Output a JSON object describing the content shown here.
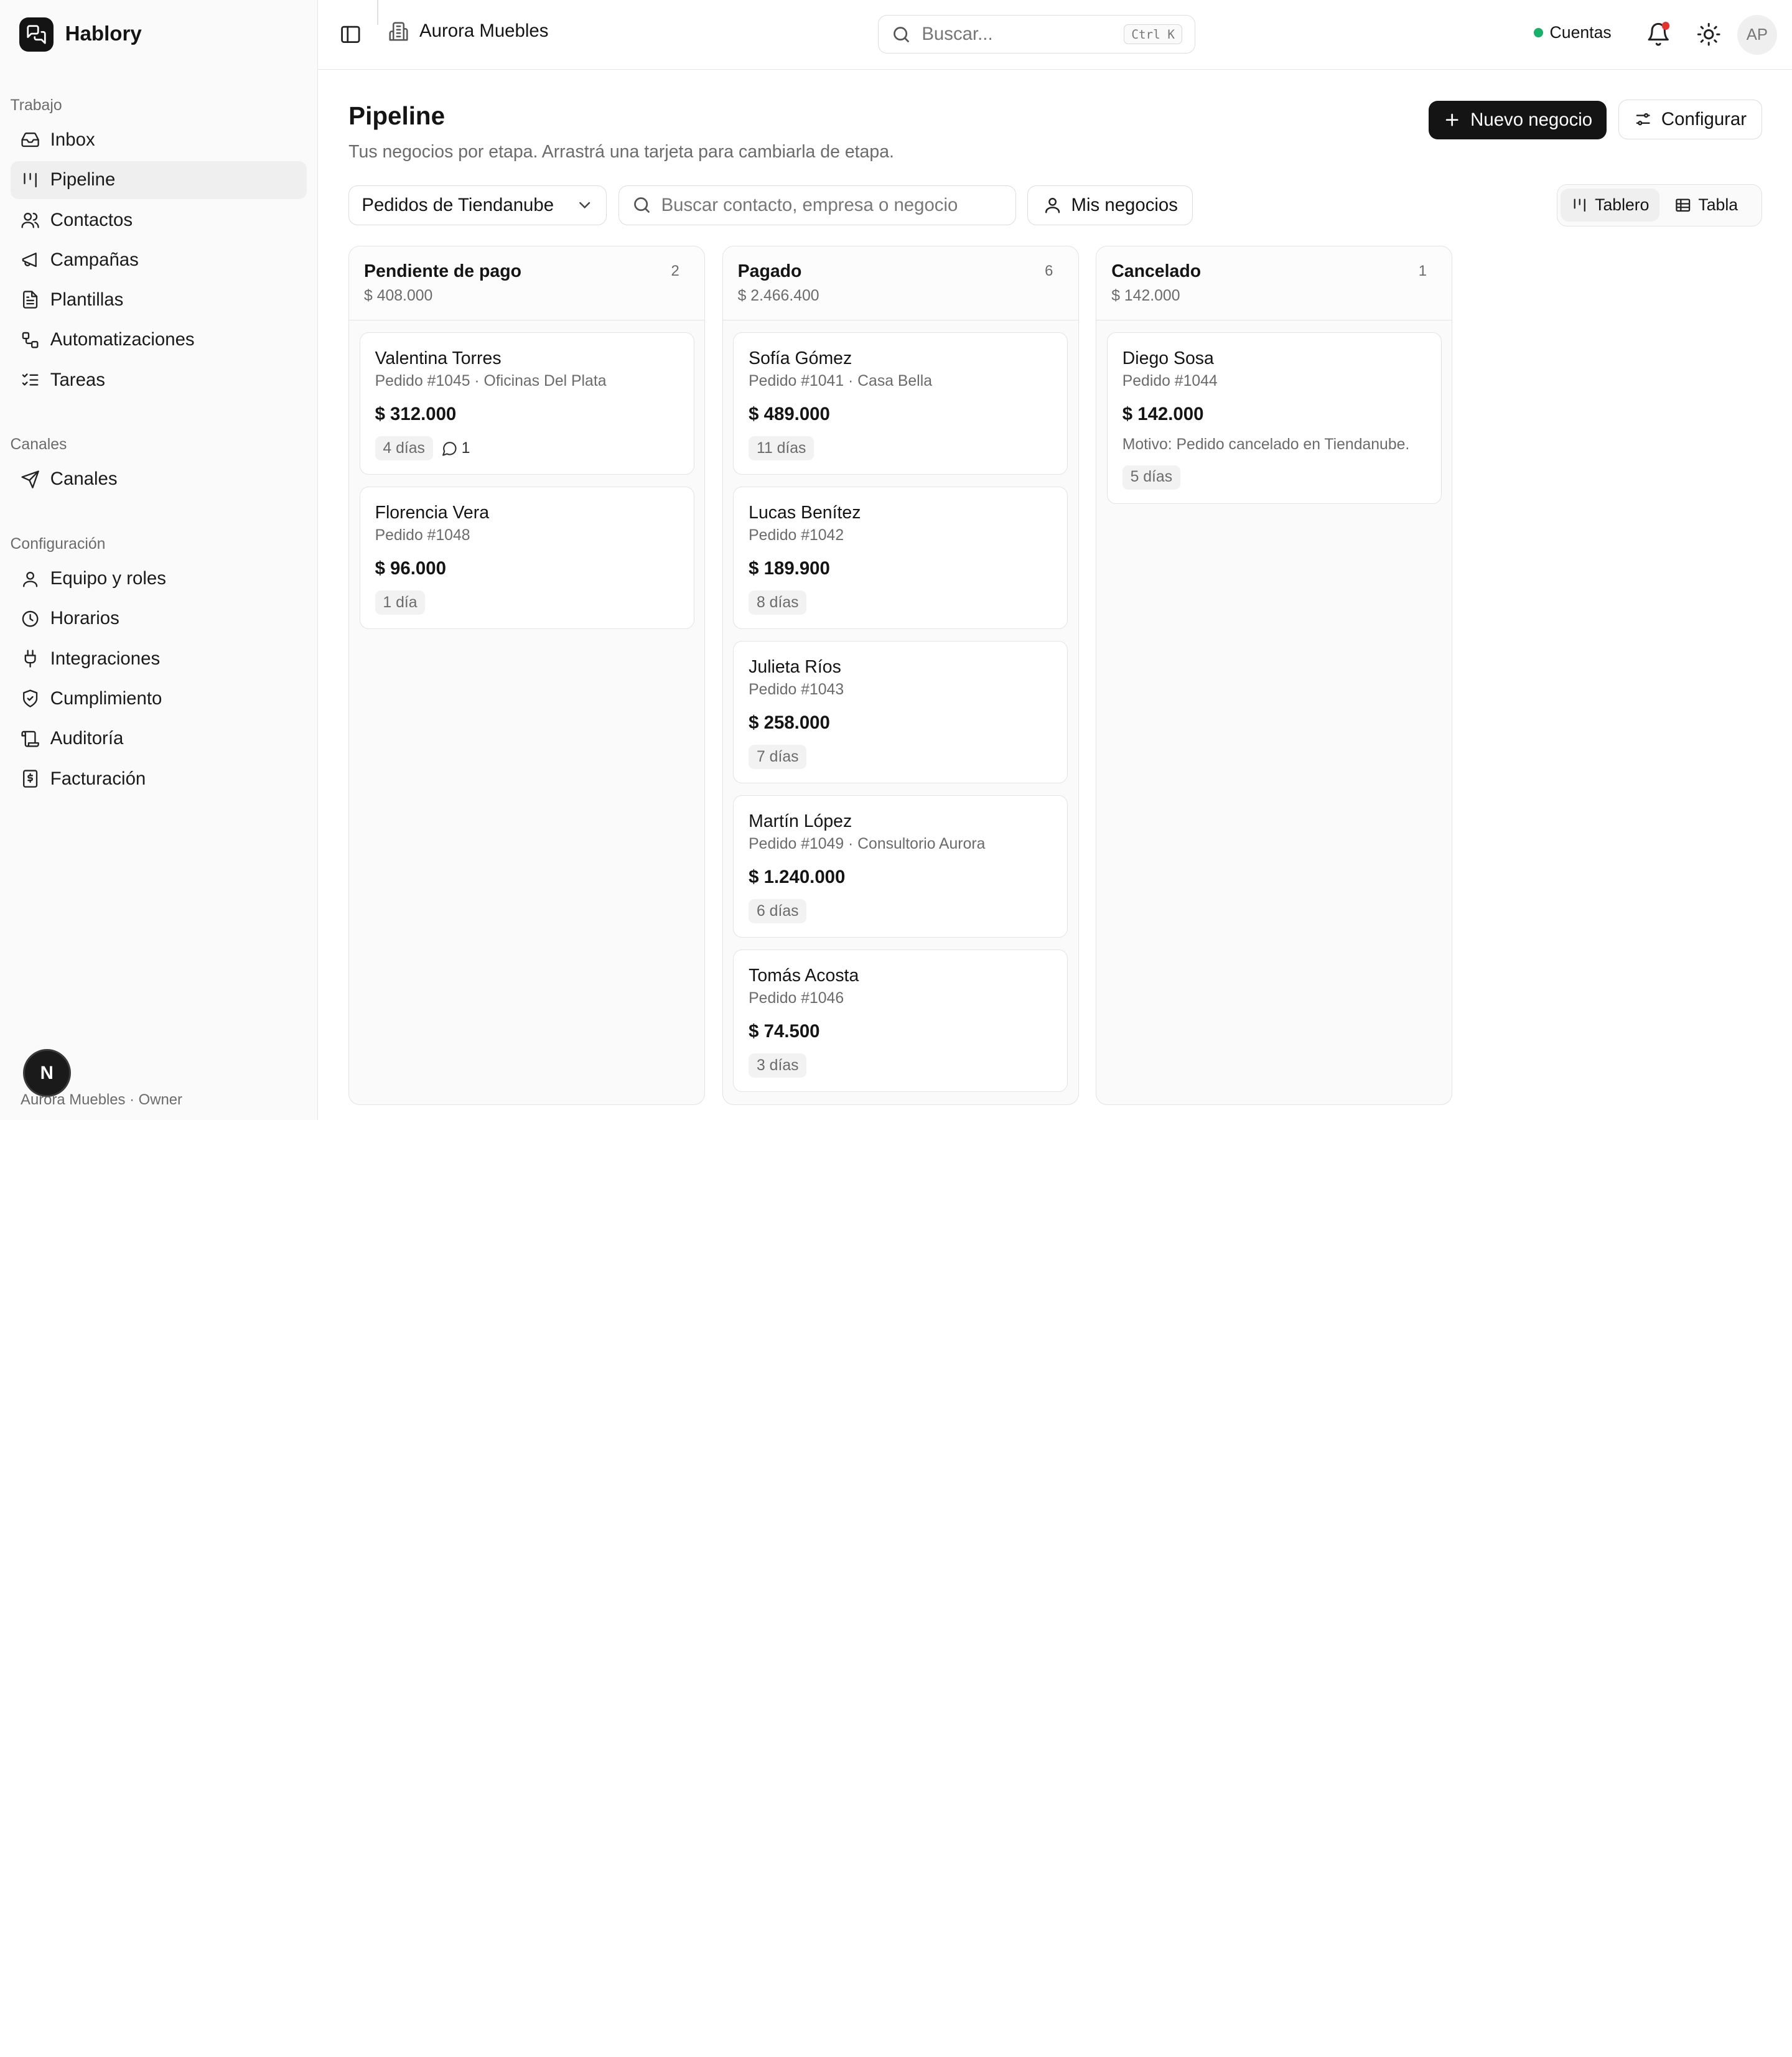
{
  "brand": {
    "name": "Hablory"
  },
  "sidebar": {
    "groups": [
      {
        "title": "Trabajo",
        "items": [
          {
            "label": "Inbox",
            "icon": "inbox-icon",
            "active": false
          },
          {
            "label": "Pipeline",
            "icon": "kanban-icon",
            "active": true
          },
          {
            "label": "Contactos",
            "icon": "users-icon",
            "active": false
          },
          {
            "label": "Campañas",
            "icon": "megaphone-icon",
            "active": false
          },
          {
            "label": "Plantillas",
            "icon": "file-icon",
            "active": false
          },
          {
            "label": "Automatizaciones",
            "icon": "workflow-icon",
            "active": false
          },
          {
            "label": "Tareas",
            "icon": "list-checks-icon",
            "active": false
          }
        ]
      },
      {
        "title": "Canales",
        "items": [
          {
            "label": "Canales",
            "icon": "send-icon",
            "active": false
          }
        ]
      },
      {
        "title": "Configuración",
        "items": [
          {
            "label": "Equipo y roles",
            "icon": "user-icon",
            "active": false
          },
          {
            "label": "Horarios",
            "icon": "clock-icon",
            "active": false
          },
          {
            "label": "Integraciones",
            "icon": "plug-icon",
            "active": false
          },
          {
            "label": "Cumplimiento",
            "icon": "shield-check-icon",
            "active": false
          },
          {
            "label": "Auditoría",
            "icon": "scroll-icon",
            "active": false
          },
          {
            "label": "Facturación",
            "icon": "receipt-icon",
            "active": false
          }
        ]
      }
    ],
    "footer": "Aurora Muebles · Owner",
    "fab_label": "N"
  },
  "topbar": {
    "workspace": "Aurora Muebles",
    "search_placeholder": "Buscar...",
    "search_shortcut": "Ctrl K",
    "accounts_label": "Cuentas",
    "avatar_initials": "AP"
  },
  "page": {
    "title": "Pipeline",
    "subtitle": "Tus negocios por etapa. Arrastrá una tarjeta para cambiarla de etapa.",
    "new_deal_label": "Nuevo negocio",
    "configure_label": "Configurar"
  },
  "filters": {
    "pipeline_selected": "Pedidos de Tiendanube",
    "search_placeholder": "Buscar contacto, empresa o negocio",
    "mine_label": "Mis negocios",
    "view_board": "Tablero",
    "view_table": "Tabla"
  },
  "columns": [
    {
      "title": "Pendiente de pago",
      "total": "$ 408.000",
      "count": "2",
      "cards": [
        {
          "name": "Valentina Torres",
          "sub": "Pedido #1045 · Oficinas Del Plata",
          "amount": "$ 312.000",
          "age": "4 días",
          "comments": "1"
        },
        {
          "name": "Florencia Vera",
          "sub": "Pedido #1048",
          "amount": "$ 96.000",
          "age": "1 día"
        }
      ]
    },
    {
      "title": "Pagado",
      "total": "$ 2.466.400",
      "count": "6",
      "cards": [
        {
          "name": "Sofía Gómez",
          "sub": "Pedido #1041 · Casa Bella",
          "amount": "$ 489.000",
          "age": "11 días"
        },
        {
          "name": "Lucas Benítez",
          "sub": "Pedido #1042",
          "amount": "$ 189.900",
          "age": "8 días"
        },
        {
          "name": "Julieta Ríos",
          "sub": "Pedido #1043",
          "amount": "$ 258.000",
          "age": "7 días"
        },
        {
          "name": "Martín López",
          "sub": "Pedido #1049 · Consultorio Aurora",
          "amount": "$ 1.240.000",
          "age": "6 días"
        },
        {
          "name": "Tomás Acosta",
          "sub": "Pedido #1046",
          "amount": "$ 74.500",
          "age": "3 días"
        }
      ]
    },
    {
      "title": "Cancelado",
      "total": "$ 142.000",
      "count": "1",
      "cards": [
        {
          "name": "Diego Sosa",
          "sub": "Pedido #1044",
          "amount": "$ 142.000",
          "reason": "Motivo: Pedido cancelado en Tiendanube.",
          "age": "5 días"
        }
      ]
    }
  ],
  "colors": {
    "accent": "#141414",
    "status_online": "#16b26a",
    "notification": "#e5322d"
  }
}
